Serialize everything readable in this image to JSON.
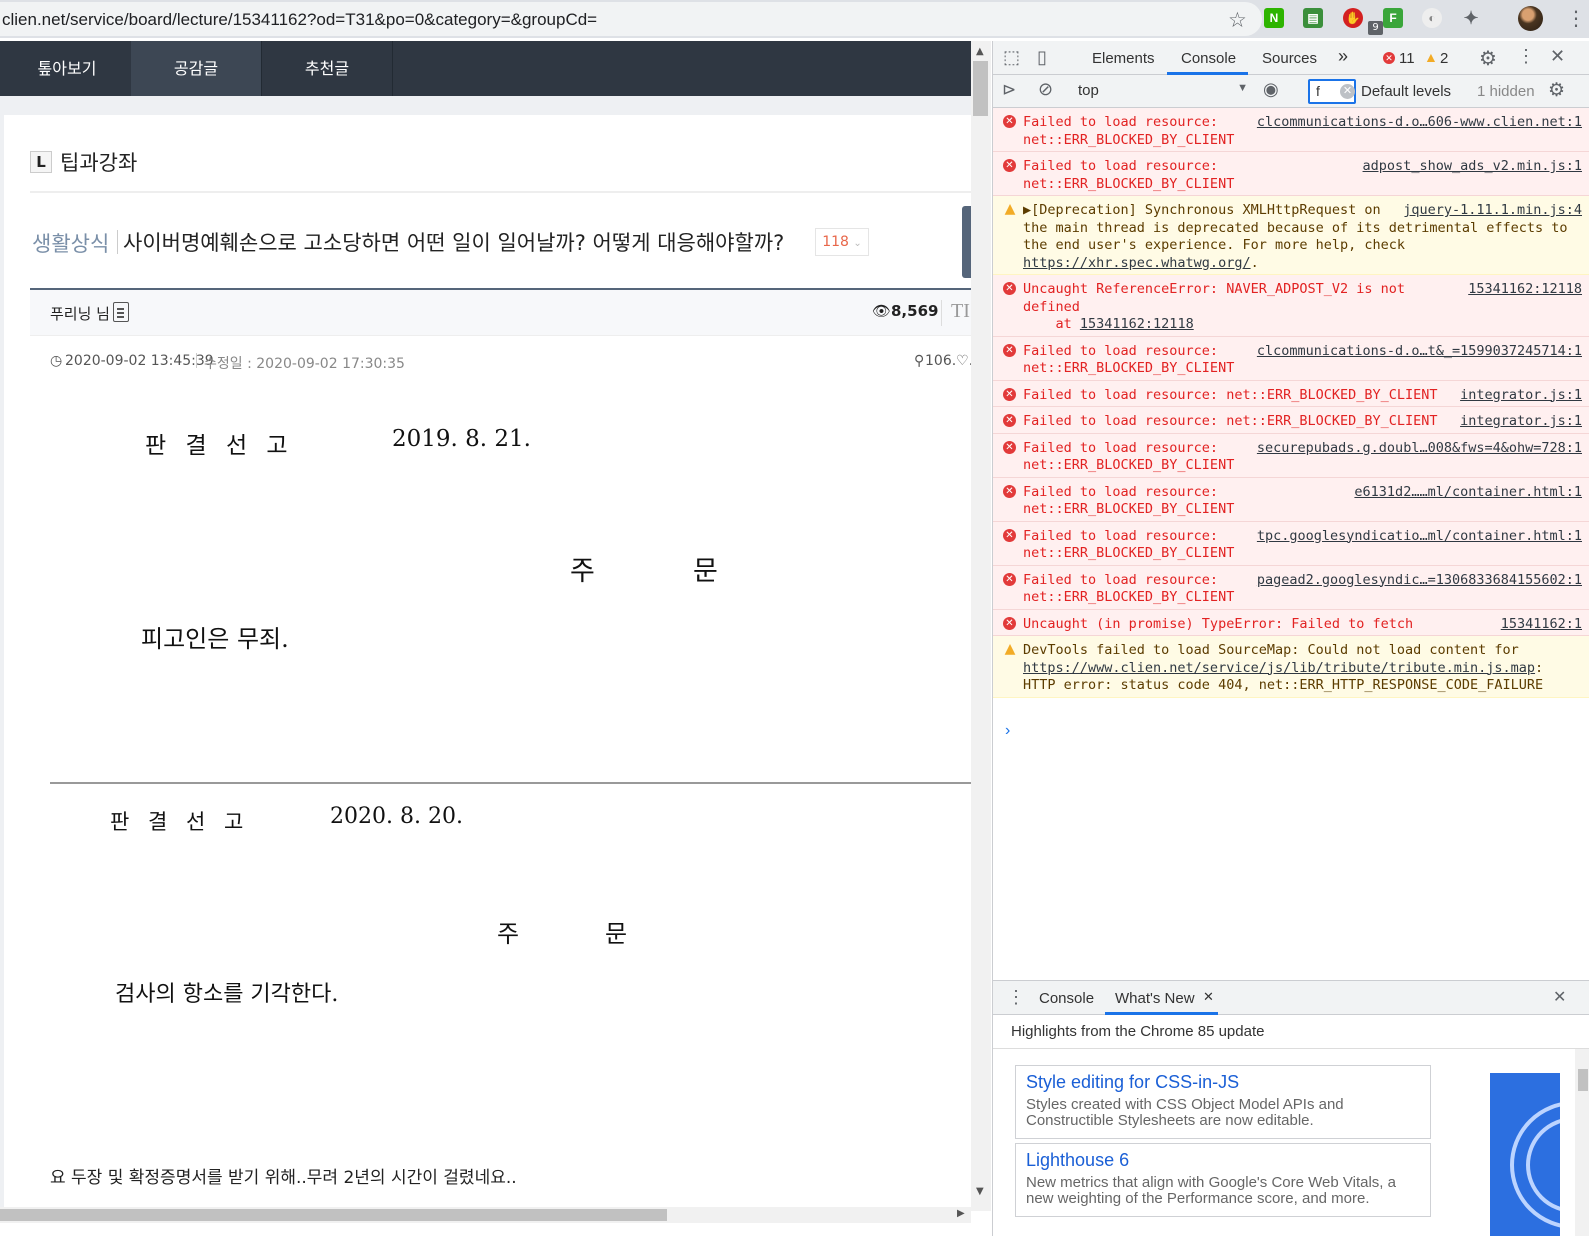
{
  "browser": {
    "url": "clien.net/service/board/lecture/15341162?od=T31&po=0&category=&groupCd=",
    "extension_badge": "9"
  },
  "site": {
    "nav_tabs": [
      "톺아보기",
      "공감글",
      "추천글"
    ],
    "board_badge": "L",
    "board_name": "팁과강좌",
    "post": {
      "category": "생활상식",
      "title": "사이버명예훼손으로 고소당하면 어떤 일이 일어날까? 어떻게 대응해야할까?",
      "comment_count": "118",
      "author": "푸리닝 님",
      "views": "8,569",
      "tl_text": "TI",
      "date": "2020-09-02 13:45:39",
      "edited": "수정일 : 2020-09-02 17:30:35",
      "ip": "106.♡.",
      "doc1": {
        "label": "판 결 선 고",
        "date": "2019. 8. 21.",
        "order_title_1": "주",
        "order_title_2": "문",
        "ruling": "피고인은 무죄."
      },
      "doc2": {
        "label": "판 결 선 고",
        "date": "2020. 8. 20.",
        "order_title_1": "주",
        "order_title_2": "문",
        "ruling": "검사의 항소를 기각한다."
      },
      "caption": "요 두장 및 확정증명서를 받기 위해..무려 2년의 시간이 걸렸네요.."
    }
  },
  "devtools": {
    "tabs": [
      "Elements",
      "Console",
      "Sources"
    ],
    "more_tabs": "»",
    "error_count": "11",
    "warning_count": "2",
    "context": "top",
    "filter_value": "f",
    "levels": "Default levels",
    "hidden": "1 hidden",
    "messages": [
      {
        "level": "error",
        "text": "Failed to load resource: net::ERR_BLOCKED_BY_CLIENT",
        "source": "clcommunications-d.o…606-www.clien.net:1"
      },
      {
        "level": "error",
        "text": "Failed to load resource: net::ERR_BLOCKED_BY_CLIENT",
        "source": "adpost_show_ads_v2.min.js:1"
      },
      {
        "level": "warn",
        "text": "▶[Deprecation] Synchronous XMLHttpRequest on the main thread is deprecated because of its detrimental effects to the end user's experience. For more help, check ",
        "link": "https://xhr.spec.whatwg.org/",
        "tail": ".",
        "source": "jquery-1.11.1.min.js:4"
      },
      {
        "level": "error",
        "text": "Uncaught ReferenceError: NAVER_ADPOST_V2 is not defined",
        "sub": "    at ",
        "sub_link": "15341162:12118",
        "source": "15341162:12118"
      },
      {
        "level": "error",
        "text": "Failed to load resource: net::ERR_BLOCKED_BY_CLIENT",
        "source": "clcommunications-d.o…t&_=1599037245714:1"
      },
      {
        "level": "error",
        "text": "Failed to load resource: net::ERR_BLOCKED_BY_CLIENT",
        "source": "integrator.js:1"
      },
      {
        "level": "error",
        "text": "Failed to load resource: net::ERR_BLOCKED_BY_CLIENT",
        "source": "integrator.js:1"
      },
      {
        "level": "error",
        "text": "Failed to load resource: net::ERR_BLOCKED_BY_CLIENT",
        "source": "securepubads.g.doubl…008&fws=4&ohw=728:1"
      },
      {
        "level": "error",
        "text": "Failed to load resource: net::ERR_BLOCKED_BY_CLIENT",
        "source": "e6131d2……ml/container.html:1"
      },
      {
        "level": "error",
        "text": "Failed to load resource: net::ERR_BLOCKED_BY_CLIENT",
        "source": "tpc.googlesyndicatio…ml/container.html:1"
      },
      {
        "level": "error",
        "text": "Failed to load resource: net::ERR_BLOCKED_BY_CLIENT",
        "source": "pagead2.googlesyndic…=1306833684155602:1"
      },
      {
        "level": "error",
        "text": "Uncaught (in promise) TypeError: Failed to fetch",
        "source": "15341162:1"
      },
      {
        "level": "warn",
        "text": "DevTools failed to load SourceMap: Could not load content for ",
        "link": "https://www.clien.net/service/js/lib/tribute/tribute.min.js.map",
        "tail": ": HTTP error: status code 404, net::ERR_HTTP_RESPONSE_CODE_FAILURE",
        "source": ""
      }
    ],
    "prompt": "›",
    "drawer": {
      "tabs": [
        "Console",
        "What's New"
      ],
      "heading": "Highlights from the Chrome 85 update",
      "cards": [
        {
          "title": "Style editing for CSS-in-JS",
          "desc": "Styles created with CSS Object Model APIs and Constructible Stylesheets are now editable."
        },
        {
          "title": "Lighthouse 6",
          "desc": "New metrics that align with Google's Core Web Vitals, a new weighting of the Performance score, and more."
        }
      ]
    }
  },
  "colors": {
    "nav_bg": "#2f3742",
    "category": "#7a8fa8",
    "comment_count": "#e8674a",
    "devtools_accent": "#1a73e8",
    "error_text": "#e22222",
    "error_bg": "#fff0f0",
    "warn_bg": "#fffbe5"
  }
}
